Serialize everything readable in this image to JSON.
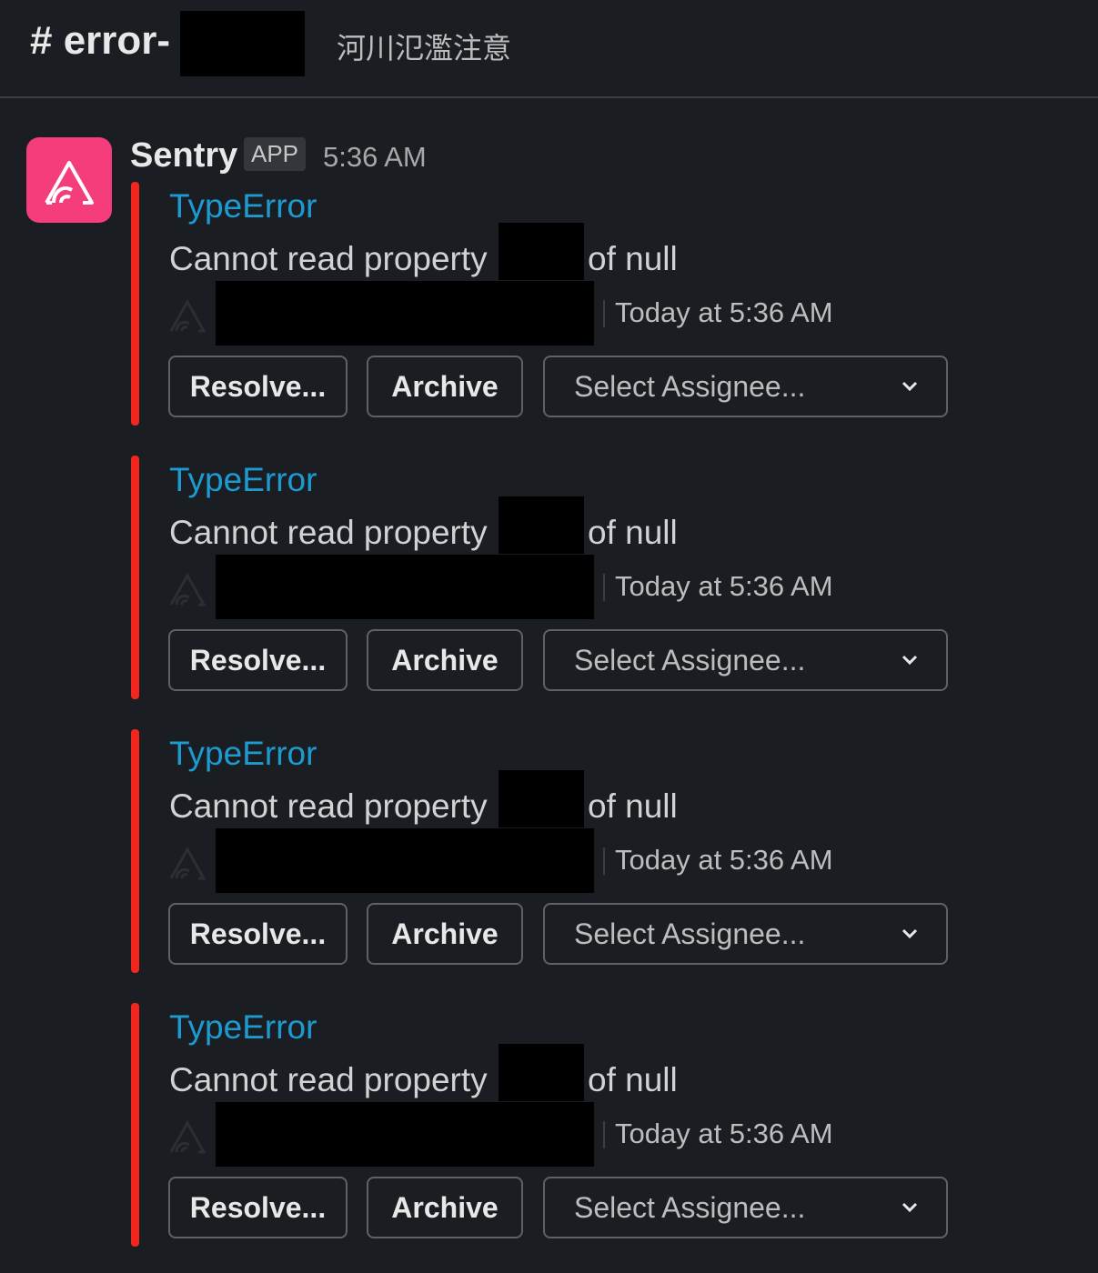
{
  "channel": {
    "name": "# error-",
    "topic": "河川氾濫注意"
  },
  "message": {
    "sender": "Sentry",
    "badge": "APP",
    "time": "5:36 AM",
    "avatar_color": "#f53d7b"
  },
  "attachments": [
    {
      "title": "TypeError",
      "text": "Cannot read property",
      "text_suffix": "of null",
      "footer_time": "Today at 5:36 AM",
      "resolve": "Resolve...",
      "archive": "Archive",
      "assignee_placeholder": "Select Assignee..."
    },
    {
      "title": "TypeError",
      "text": "Cannot read property",
      "text_suffix": "of null",
      "footer_time": "Today at 5:36 AM",
      "resolve": "Resolve...",
      "archive": "Archive",
      "assignee_placeholder": "Select Assignee..."
    },
    {
      "title": "TypeError",
      "text": "Cannot read property",
      "text_suffix": "of null",
      "footer_time": "Today at 5:36 AM",
      "resolve": "Resolve...",
      "archive": "Archive",
      "assignee_placeholder": "Select Assignee..."
    },
    {
      "title": "TypeError",
      "text": "Cannot read property",
      "text_suffix": "of null",
      "footer_time": "Today at 5:36 AM",
      "resolve": "Resolve...",
      "archive": "Archive",
      "assignee_placeholder": "Select Assignee..."
    }
  ],
  "colors": {
    "accent_bar": "#f2261f",
    "title_link": "#1d9bd1",
    "background": "#1a1d21"
  }
}
